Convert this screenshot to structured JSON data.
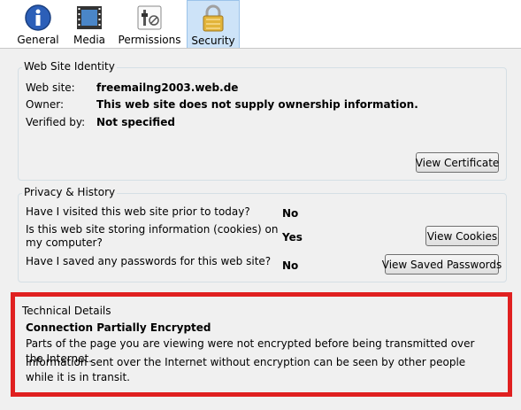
{
  "tabs": [
    {
      "label": "General",
      "icon": "info-icon"
    },
    {
      "label": "Media",
      "icon": "film-icon"
    },
    {
      "label": "Permissions",
      "icon": "toggle-switch-icon"
    },
    {
      "label": "Security",
      "icon": "lock-icon",
      "selected": true
    }
  ],
  "identity": {
    "legend": "Web Site Identity",
    "website_label": "Web site:",
    "website_value": "freemailng2003.web.de",
    "owner_label": "Owner:",
    "owner_value": "This web site does not supply ownership information.",
    "verified_label": "Verified by:",
    "verified_value": "Not specified",
    "view_certificate": "View Certificate"
  },
  "privacy": {
    "legend": "Privacy & History",
    "q1": "Have I visited this web site prior to today?",
    "a1": "No",
    "q2_line1": "Is this web site storing information (cookies) on",
    "q2_line2": "my computer?",
    "a2": "Yes",
    "q3": "Have I saved any passwords for this web site?",
    "a3": "No",
    "view_cookies": "View Cookies",
    "view_saved_passwords": "View Saved Passwords"
  },
  "technical": {
    "legend": "Technical Details",
    "heading": "Connection Partially Encrypted",
    "line1": "Parts of the page you are viewing were not encrypted before being transmitted over the Internet.",
    "line2": "Information sent over the Internet without encryption can be seen by other people while it is in transit.",
    "highlight_color": "#e02020"
  },
  "colors": {
    "selected_tab_bg": "#cde3f8",
    "window_bg": "#f0f0f0"
  }
}
